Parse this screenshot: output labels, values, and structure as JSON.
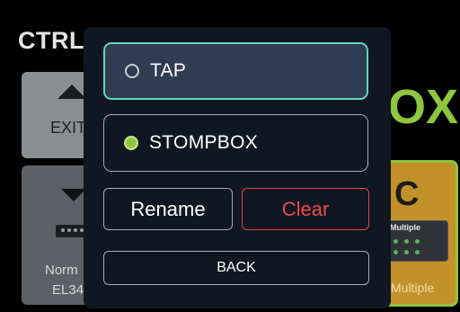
{
  "background": {
    "ctrl_title": "CTRL",
    "mode_text": "OX",
    "exit_label": "EXIT",
    "preset_line1": "Norm",
    "preset_line2": "EL34",
    "c_letter": "C",
    "c_thumb_label": "Multiple",
    "c_caption": "Multiple"
  },
  "modal": {
    "options": [
      {
        "label": "TAP",
        "selected": false
      },
      {
        "label": "STOMPBOX",
        "selected": true
      }
    ],
    "rename_label": "Rename",
    "clear_label": "Clear",
    "back_label": "BACK"
  },
  "colors": {
    "accent_green": "#8ec63f",
    "selected_border": "#63d7ba",
    "danger_red": "#ee4a4d",
    "modal_bg": "#101722",
    "tile_orange": "#c3912a"
  }
}
